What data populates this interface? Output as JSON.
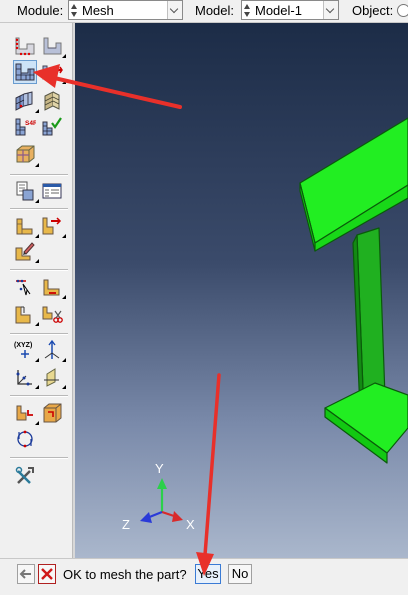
{
  "context_bar": {
    "module_label": "Module:",
    "module_value": "Mesh",
    "model_label": "Model:",
    "model_value": "Model-1",
    "object_label": "Object:"
  },
  "toolbox": {
    "tools": [
      "seed-edges-icon",
      "seed-part-icon",
      "mesh-part-icon",
      "delete-mesh-icon",
      "assign-mesh-controls-icon",
      "assign-stack-direction-icon",
      "assign-element-type-icon",
      "verify-mesh-icon",
      "partition-cell-icon",
      "query-icon",
      "report-icon",
      "edit-mesh-icon",
      "edit-mesh-nodes-icon",
      "create-mesh-part-icon",
      "virtual-topology-icon",
      "combine-faces-icon",
      "mesh-region-icon",
      "delete-region-icon",
      "datum-point-icon",
      "datum-axis-icon",
      "datum-plane-icon",
      "datum-csys-icon",
      "partition-face-icon",
      "partition-edge-icon",
      "cycle-icon",
      "tools-icon"
    ]
  },
  "viewport": {
    "part_color": "#1ee81e",
    "part_edge_color": "#0a5a0a",
    "triad": {
      "y_label": "Y",
      "z_label": "Z",
      "x_label": "X"
    }
  },
  "prompt": {
    "message": "OK to mesh the part?",
    "yes_label": "Yes",
    "no_label": "No"
  },
  "annotation": {
    "arrow_color": "#e8302a"
  }
}
